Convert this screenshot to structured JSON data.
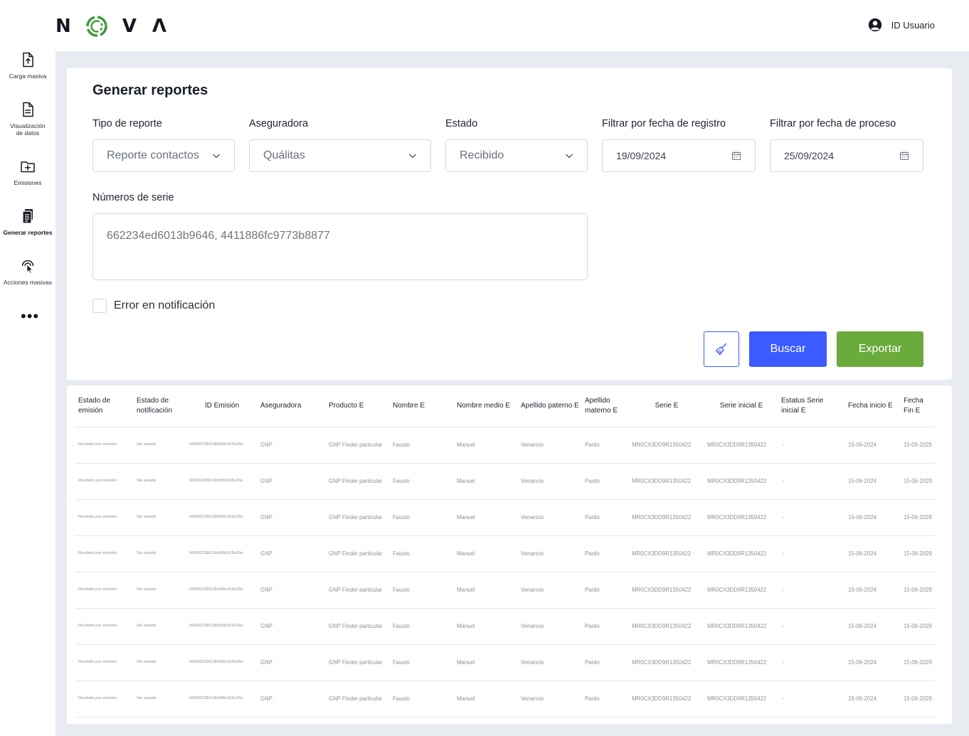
{
  "header": {
    "logo_letters": [
      "N",
      "V",
      "Λ"
    ],
    "user_label": "ID Usuario"
  },
  "sidebar": {
    "items": [
      {
        "label": "Carga masiva",
        "icon": "file-upload-icon"
      },
      {
        "label": "Visualización de datos",
        "icon": "file-text-icon"
      },
      {
        "label": "Emisiones",
        "icon": "folder-plus-icon"
      },
      {
        "label": "Generar reportes",
        "icon": "clipboard-report-icon",
        "active": true
      },
      {
        "label": "Acciones masivas",
        "icon": "pointer-click-icon"
      }
    ],
    "more_label": "•••"
  },
  "form": {
    "title": "Generar reportes",
    "tipo": {
      "label": "Tipo de reporte",
      "value": "Reporte contactos"
    },
    "aseguradora": {
      "label": "Aseguradora",
      "value": "Quálitas"
    },
    "estado": {
      "label": "Estado",
      "value": "Recibido"
    },
    "fecha_registro": {
      "label": "Filtrar por fecha de registro",
      "value": "19/09/2024"
    },
    "fecha_proceso": {
      "label": "Filtrar por fecha de proceso",
      "value": "25/09/2024"
    },
    "series": {
      "label": "Números de serie",
      "placeholder": "662234ed6013b9646, 4411886fc9773b8877"
    },
    "error_checkbox": {
      "label": "Error en notificación",
      "checked": false
    },
    "buscar_label": "Buscar",
    "exportar_label": "Exportar",
    "colors": {
      "primary": "#3b5bff",
      "export": "#6aab3c",
      "logo_green": "#3d9a3a"
    }
  },
  "table": {
    "headers": [
      "Estado de emisión",
      "Estado de notificación",
      "ID Emisión",
      "Aseguradora",
      "Producto E",
      "Nombre E",
      "Nombre medio E",
      "Apellido paterno E",
      "Apellido materno E",
      "Serie E",
      "Serie inicial E",
      "Estatus Serie inicial E",
      "Fecha inicio E",
      "Fecha Fin E"
    ],
    "rows": [
      [
        "Recibido por emisión",
        "Sin estado",
        "6660f2236013b958c915e20a",
        "GNP",
        "GNP Finder particular",
        "Fausto",
        "Manuel",
        "Venancio",
        "Pardo",
        "MR0CX3DD9R1350422",
        "MR0CX3DD9R1350422",
        "-",
        "15-06-2024",
        "15-06-2029"
      ],
      [
        "Recibido por emisión",
        "Sin estado",
        "6660f2236013b958c915e20a",
        "GNP",
        "GNP Finder particular",
        "Fausto",
        "Manuel",
        "Venancio",
        "Pardo",
        "MR0CX3DD9R1350422",
        "MR0CX3DD9R1350422",
        "-",
        "15-06-2024",
        "15-06-2029"
      ],
      [
        "Recibido por emisión",
        "Sin estado",
        "6660f2236013b958c915e20a",
        "GNP",
        "GNP Finder particular",
        "Fausto",
        "Manuel",
        "Venancio",
        "Pardo",
        "MR0CX3DD9R1350422",
        "MR0CX3DD9R1350422",
        "-",
        "15-06-2024",
        "15-06-2029"
      ],
      [
        "Recibido por emisión",
        "Sin estado",
        "6660f2236013b958c915e20a",
        "GNP",
        "GNP Finder particular",
        "Fausto",
        "Manuel",
        "Venancio",
        "Pardo",
        "MR0CX3DD9R1350422",
        "MR0CX3DD9R1350422",
        "-",
        "15-06-2024",
        "15-06-2029"
      ],
      [
        "Recibido por emisión",
        "Sin estado",
        "6660f2236013b958c915e20a",
        "GNP",
        "GNP Finder particular",
        "Fausto",
        "Manuel",
        "Venancio",
        "Pardo",
        "MR0CX3DD9R1350422",
        "MR0CX3DD9R1350422",
        "-",
        "15-06-2024",
        "15-06-2029"
      ],
      [
        "Recibido por emisión",
        "Sin estado",
        "6660f2236013b958c915e20a",
        "GNP",
        "GNP Finder particular",
        "Fausto",
        "Manuel",
        "Venancio",
        "Pardo",
        "MR0CX3DD9R1350422",
        "MR0CX3DD9R1350422",
        "-",
        "15-06-2024",
        "15-06-2029"
      ],
      [
        "Recibido por emisión",
        "Sin estado",
        "6660f2236013b958c915e20a",
        "GNP",
        "GNP Finder particular",
        "Fausto",
        "Manuel",
        "Venancio",
        "Pardo",
        "MR0CX3DD9R1350422",
        "MR0CX3DD9R1350422",
        "-",
        "15-06-2024",
        "15-06-2029"
      ],
      [
        "Recibido por emisión",
        "Sin estado",
        "6660f2236013b958c915e20a",
        "GNP",
        "GNP Finder particular",
        "Fausto",
        "Manuel",
        "Venancio",
        "Pardo",
        "MR0CX3DD9R1350422",
        "MR0CX3DD9R1350422",
        "-",
        "15-06-2024",
        "15-06-2029"
      ]
    ]
  }
}
